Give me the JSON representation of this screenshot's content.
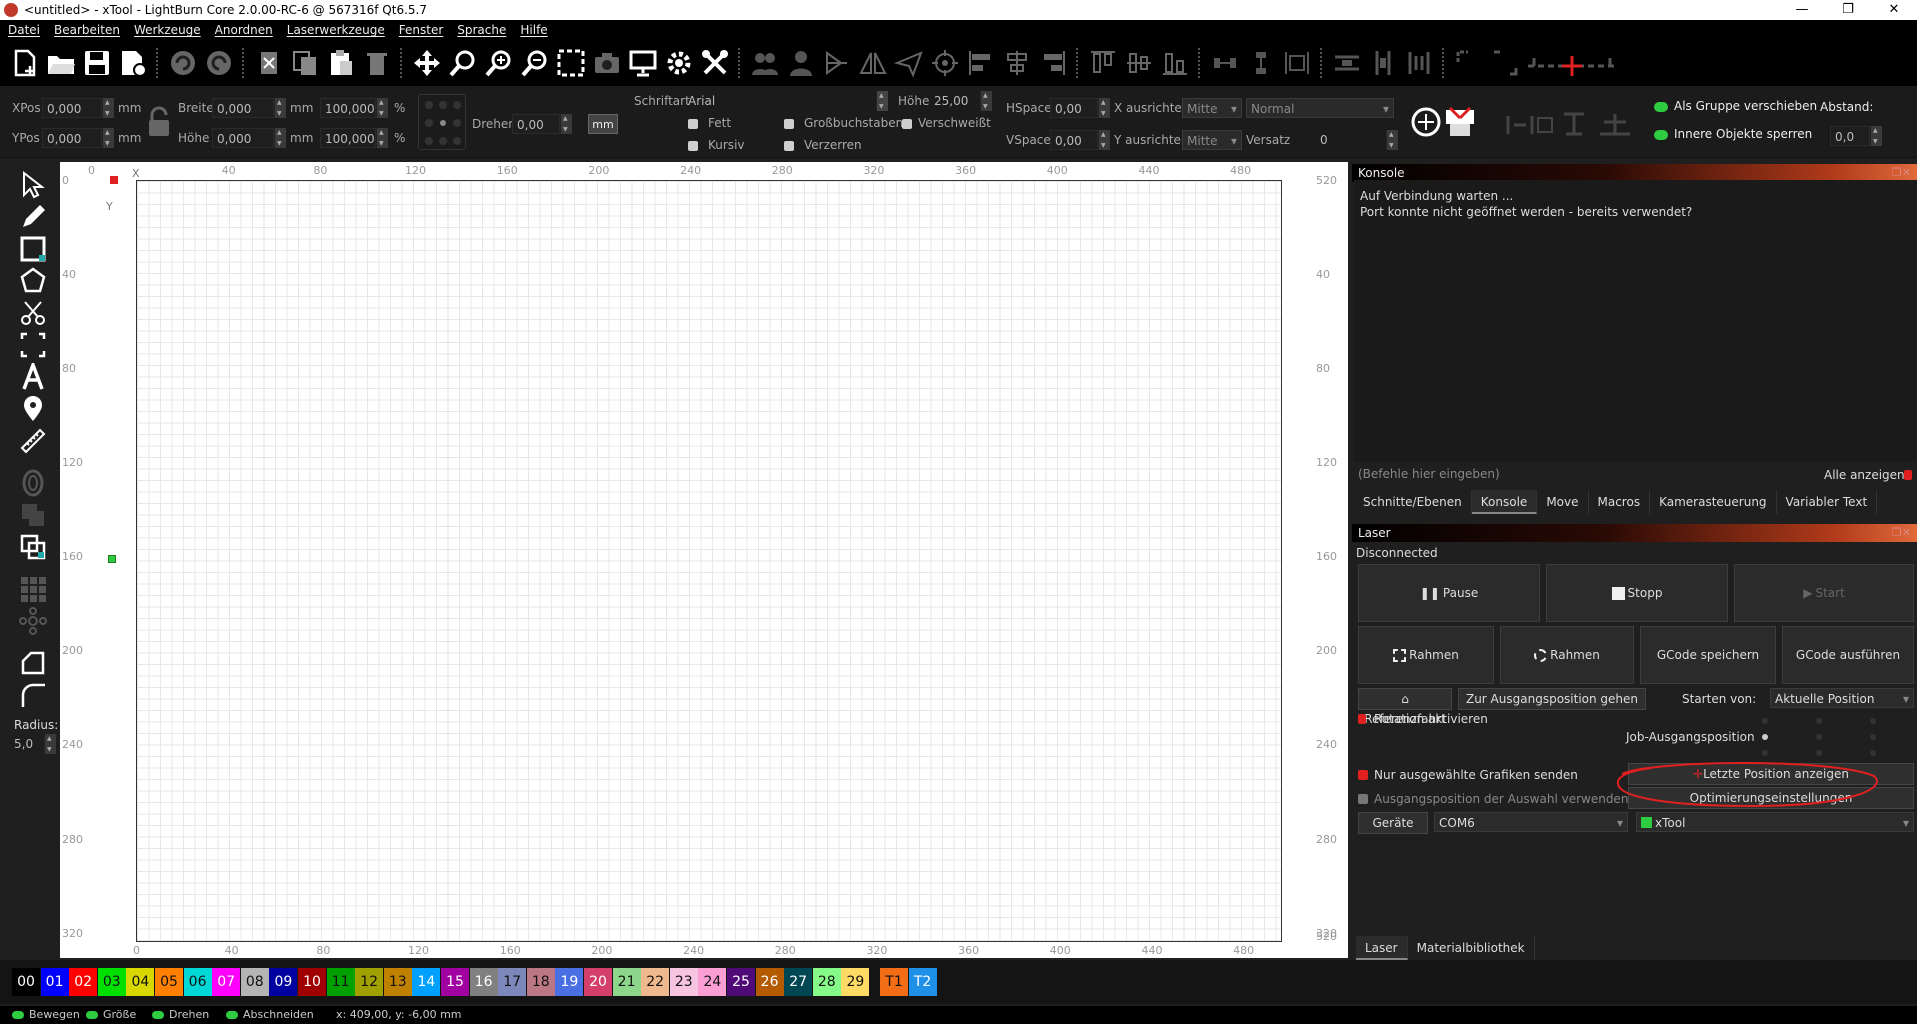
{
  "window": {
    "title": "<untitled> - xTool - LightBurn Core 2.0.00-RC-6 @ 567316f Qt6.5.7",
    "controls": [
      "—",
      "❐",
      "✕"
    ]
  },
  "menu": [
    "Datei",
    "Bearbeiten",
    "Werkzeuge",
    "Anordnen",
    "Laserwerkzeuge",
    "Fenster",
    "Sprache",
    "Hilfe"
  ],
  "toolbar_icons": [
    "new-file-icon",
    "open-folder-icon",
    "save-icon",
    "save-as-icon",
    "undo-icon",
    "redo-icon",
    "import-icon",
    "copy-icon",
    "paste-icon",
    "delete-icon",
    "move-icon",
    "zoom-icon",
    "zoom-in-icon",
    "zoom-out-icon",
    "select-frame-icon",
    "camera-icon",
    "monitor-icon",
    "settings-icon",
    "tools-icon",
    "group-icon",
    "user-icon",
    "flip-icon",
    "mirror-icon",
    "send-icon",
    "target-icon",
    "align-left-icon",
    "align-center-icon",
    "align-right-icon",
    "align-top-icon",
    "align-middle-icon",
    "align-bottom-icon",
    "distribute-h-icon",
    "distribute-v-icon",
    "dock-icon",
    "space-h-icon",
    "space-v-icon",
    "bracket-icon",
    "corner-icon",
    "dotted-line-icon",
    "crosshair-icon"
  ],
  "props": {
    "xpos_label": "XPos",
    "xpos": "0,000",
    "ypos_label": "YPos",
    "ypos": "0,000",
    "unit": "mm",
    "width_label": "Breite",
    "width": "0,000",
    "height_label": "Höhe",
    "height": "0,000",
    "scale_w": "100,000",
    "scale_h": "100,000",
    "percent": "%",
    "rotate_label": "Drehen",
    "rotate": "0,00",
    "mm_button": "mm",
    "font_label": "Schriftart",
    "font": "Arial",
    "font_height_label": "Höhe",
    "font_height": "25,00",
    "bold": "Fett",
    "italic": "Kursiv",
    "caps": "Großbuchstaben",
    "distort": "Verzerren",
    "welded": "Verschweißt",
    "hspace_label": "HSpace",
    "hspace": "0,00",
    "vspace_label": "VSpace",
    "vspace": "0,00",
    "xalign_label": "X ausrichten",
    "xalign": "Mitte",
    "yalign_label": "Y ausrichten",
    "yalign": "Mitte",
    "mode": "Normal",
    "offset_label": "Versatz",
    "offset": "0",
    "move_as_group": "Als Gruppe verschieben",
    "lock_inner": "Innere Objekte sperren",
    "distance_label": "Abstand:",
    "distance": "0,0"
  },
  "left_tools": {
    "radius_label": "Radius:",
    "radius": "5,0"
  },
  "canvas": {
    "x_axis": "X",
    "y_axis": "Y",
    "top_ticks": [
      "0",
      "40",
      "80",
      "120",
      "160",
      "200",
      "240",
      "280",
      "320",
      "360",
      "400",
      "440",
      "480"
    ],
    "left_ticks": [
      "0",
      "40",
      "80",
      "120",
      "160",
      "200",
      "240",
      "280",
      "320"
    ],
    "right_ticks": [
      "520",
      "40",
      "80",
      "120",
      "160",
      "200",
      "240",
      "280",
      "320",
      "520"
    ],
    "bottom_ticks": [
      "0",
      "40",
      "80",
      "120",
      "160",
      "200",
      "240",
      "280",
      "320",
      "360",
      "400",
      "440",
      "480"
    ]
  },
  "console": {
    "title": "Konsole",
    "lines": [
      "Auf Verbindung warten ...",
      "Port konnte nicht geöffnet werden - bereits verwendet?"
    ],
    "input_placeholder": "(Befehle hier eingeben)",
    "show_all": "Alle anzeigen",
    "tabs": [
      "Schnitte/Ebenen",
      "Konsole",
      "Move",
      "Macros",
      "Kamerasteuerung",
      "Variabler Text"
    ]
  },
  "laser": {
    "title": "Laser",
    "status": "Disconnected",
    "pause": "Pause",
    "stop": "Stopp",
    "start": "Start",
    "frame1": "Rahmen",
    "frame2": "Rahmen",
    "save_gcode": "GCode speichern",
    "run_gcode": "GCode ausführen",
    "home": "Referenzfahrt",
    "go_origin": "Zur Ausgangsposition gehen",
    "start_from_label": "Starten von:",
    "start_from": "Aktuelle Position",
    "rotary": "Rotation aktivieren",
    "job_origin": "Job-Ausgangsposition",
    "only_selected": "Nur ausgewählte Grafiken senden",
    "use_selection_origin": "Ausgangsposition der Auswahl verwenden",
    "last_position": "Letzte Position anzeigen",
    "optimize": "Optimierungseinstellungen",
    "devices": "Geräte",
    "port": "COM6",
    "device": "xTool",
    "bottom_tabs": [
      "Laser",
      "Materialbibliothek"
    ]
  },
  "palette": [
    {
      "label": "00",
      "color": "#000000",
      "text": "#ffffff"
    },
    {
      "label": "01",
      "color": "#0000ff",
      "text": "#ffffff"
    },
    {
      "label": "02",
      "color": "#ff0000",
      "text": "#ffffff"
    },
    {
      "label": "03",
      "color": "#00e000",
      "text": "#111111"
    },
    {
      "label": "04",
      "color": "#d8d800",
      "text": "#111111"
    },
    {
      "label": "05",
      "color": "#ff8000",
      "text": "#111111"
    },
    {
      "label": "06",
      "color": "#00d8d8",
      "text": "#111111"
    },
    {
      "label": "07",
      "color": "#ff00ff",
      "text": "#ffffff"
    },
    {
      "label": "08",
      "color": "#b4b4b4",
      "text": "#111111"
    },
    {
      "label": "09",
      "color": "#0000a0",
      "text": "#ffffff"
    },
    {
      "label": "10",
      "color": "#a00000",
      "text": "#ffffff"
    },
    {
      "label": "11",
      "color": "#00a000",
      "text": "#111111"
    },
    {
      "label": "12",
      "color": "#a0a000",
      "text": "#111111"
    },
    {
      "label": "13",
      "color": "#c08000",
      "text": "#111111"
    },
    {
      "label": "14",
      "color": "#00a0ff",
      "text": "#ffffff"
    },
    {
      "label": "15",
      "color": "#a000a0",
      "text": "#ffffff"
    },
    {
      "label": "16",
      "color": "#808080",
      "text": "#ffffff"
    },
    {
      "label": "17",
      "color": "#7d87b9",
      "text": "#111111"
    },
    {
      "label": "18",
      "color": "#bb7784",
      "text": "#111111"
    },
    {
      "label": "19",
      "color": "#4a6fe3",
      "text": "#ffffff"
    },
    {
      "label": "20",
      "color": "#d33f6a",
      "text": "#ffffff"
    },
    {
      "label": "21",
      "color": "#8cd78c",
      "text": "#111111"
    },
    {
      "label": "22",
      "color": "#f0b98d",
      "text": "#111111"
    },
    {
      "label": "23",
      "color": "#f6c4e1",
      "text": "#111111"
    },
    {
      "label": "24",
      "color": "#fa9ed4",
      "text": "#111111"
    },
    {
      "label": "25",
      "color": "#500a78",
      "text": "#ffffff"
    },
    {
      "label": "26",
      "color": "#b45a00",
      "text": "#ffffff"
    },
    {
      "label": "27",
      "color": "#004754",
      "text": "#ffffff"
    },
    {
      "label": "28",
      "color": "#86fa88",
      "text": "#111111"
    },
    {
      "label": "29",
      "color": "#ffdb66",
      "text": "#111111"
    },
    {
      "label": "T1",
      "color": "#f36d17",
      "text": "#111111"
    },
    {
      "label": "T2",
      "color": "#1e90e8",
      "text": "#ffffff"
    }
  ],
  "status": {
    "move": "Bewegen",
    "size": "Größe",
    "rotate": "Drehen",
    "cut": "Abschneiden",
    "coords": "x: 409,00, y: -6,00 mm"
  },
  "colors": {
    "accent_red": "#e02020",
    "panel_gradient_end": "#e06a3a",
    "toggle_green": "#2ecc40"
  }
}
